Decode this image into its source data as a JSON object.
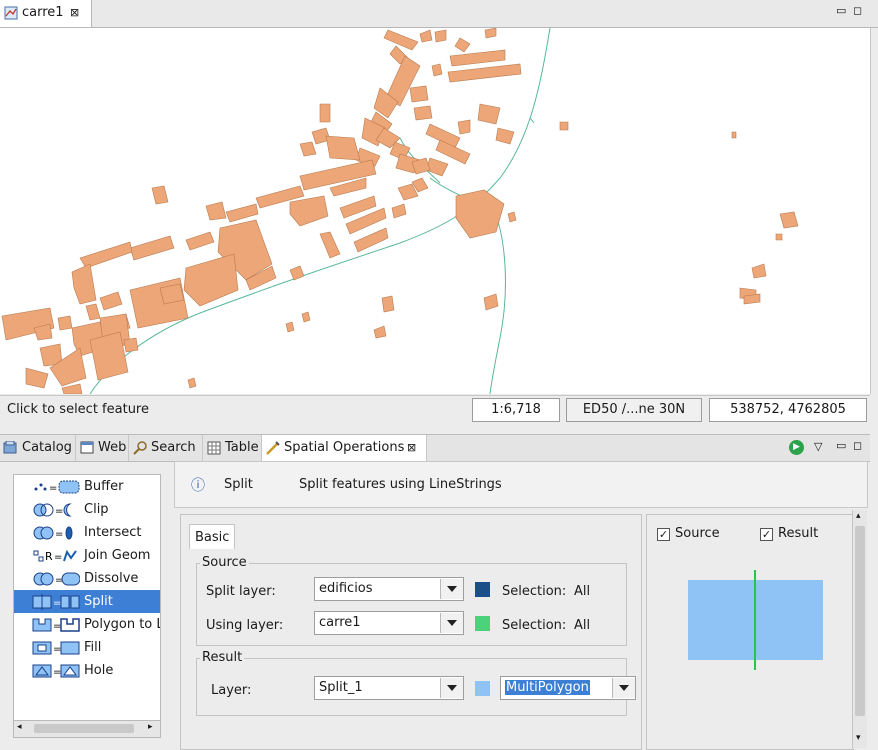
{
  "editor": {
    "tab_label": "carre1",
    "close_glyph": "⊠",
    "min_glyph": "▭",
    "max_glyph": "◻"
  },
  "status": {
    "message": "Click to select feature",
    "scale": "1:6,718",
    "crs": "ED50 /...ne 30N",
    "coords": "538752, 4762805"
  },
  "views": {
    "tabs": [
      {
        "label": "Catalog",
        "icon": "catalog-icon"
      },
      {
        "label": "Web",
        "icon": "web-icon"
      },
      {
        "label": "Search",
        "icon": "search-icon"
      },
      {
        "label": "Table",
        "icon": "table-icon"
      },
      {
        "label": "Spatial Operations",
        "icon": "spatial-ops-icon"
      }
    ],
    "close_glyph": "⊠",
    "run_glyph": "▶",
    "menu_glyph": "▽"
  },
  "operations": [
    {
      "label": "Buffer",
      "icon": "buffer-icon"
    },
    {
      "label": "Clip",
      "icon": "clip-icon"
    },
    {
      "label": "Intersect",
      "icon": "intersect-icon"
    },
    {
      "label": "Join Geom",
      "icon": "join-geom-icon"
    },
    {
      "label": "Dissolve",
      "icon": "dissolve-icon"
    },
    {
      "label": "Split",
      "icon": "split-icon",
      "selected": true
    },
    {
      "label": "Polygon to L",
      "icon": "polygon-to-line-icon"
    },
    {
      "label": "Fill",
      "icon": "fill-icon"
    },
    {
      "label": "Hole",
      "icon": "hole-icon"
    }
  ],
  "description": {
    "info_glyph": "ⓘ",
    "name": "Split",
    "text": "Split features using LineStrings"
  },
  "basic": {
    "tab_label": "Basic",
    "source_title": "Source",
    "split_layer_label": "Split layer:",
    "split_layer_value": "edificios",
    "split_layer_color": "#1b4f8a",
    "using_layer_label": "Using layer:",
    "using_layer_value": "carre1",
    "using_layer_color": "#4cd27a",
    "selection_label": "Selection:",
    "selection_value": "All",
    "result_title": "Result",
    "layer_label": "Layer:",
    "layer_value": "Split_1",
    "result_color": "#8fc3f5",
    "geometry_value": "MultiPolygon"
  },
  "preview": {
    "source_label": "Source",
    "result_label": "Result",
    "source_checked": "✓",
    "result_checked": "✓",
    "polygon_color": "#8fc3f5",
    "line_color": "#2bc24f"
  },
  "map": {
    "building_fill": "#eca677",
    "building_stroke": "#b87a50",
    "road_color": "#59b89a"
  }
}
